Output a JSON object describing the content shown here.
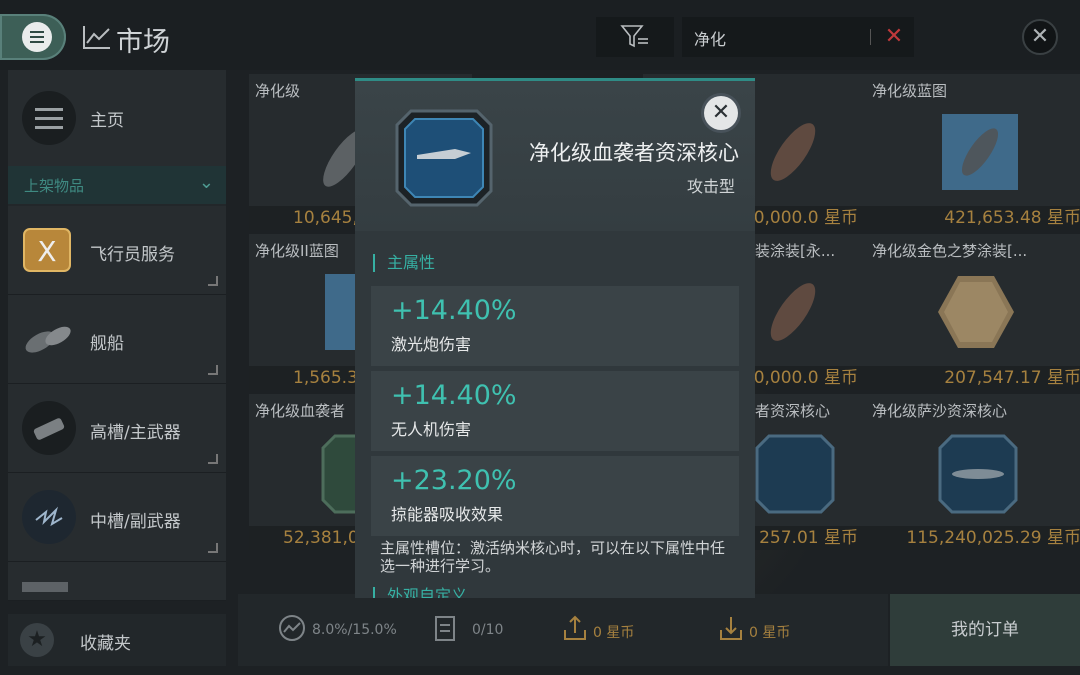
{
  "header": {
    "title": "市场",
    "search": {
      "value": "净化"
    }
  },
  "sidebar": {
    "home": "主页",
    "listed_header": "上架物品",
    "items": [
      {
        "label": "飞行员服务"
      },
      {
        "label": "舰船"
      },
      {
        "label": "高槽/主武器"
      },
      {
        "label": "中槽/副武器"
      }
    ],
    "favorites": "收藏夹"
  },
  "grid": {
    "cards": [
      {
        "name": "净化级",
        "price": "10,645,",
        "price_side": "left"
      },
      {
        "name": "",
        "price": "0,000.0 星币",
        "price_side": "right"
      },
      {
        "name": "净化级蓝图",
        "price": "421,653.48 星币",
        "price_side": "right"
      },
      {
        "name": "净化级II蓝图",
        "price": "1,565.3",
        "price_side": "left"
      },
      {
        "name": "装涂装[永...",
        "price": "0,000.0 星币",
        "price_side": "right"
      },
      {
        "name": "净化级金色之梦涂装[...",
        "price": "207,547.17 星币",
        "price_side": "right"
      },
      {
        "name": "净化级血袭者",
        "price": "52,381,0",
        "price_side": "left"
      },
      {
        "name": "者资深核心",
        "price": "257.01 星币",
        "price_side": "right"
      },
      {
        "name": "净化级萨沙资深核心",
        "price": "115,240,025.29 星币",
        "price_side": "right"
      }
    ]
  },
  "bottom": {
    "rate": "8.0%/15.0%",
    "orders_count": "0/10",
    "sell_amount": "0 星币",
    "buy_amount": "0 星币",
    "my_orders": "我的订单"
  },
  "modal": {
    "item_name": "净化级血袭者资深核心",
    "item_type": "攻击型",
    "main_attr_title": "主属性",
    "attributes": [
      {
        "value": "+14.40%",
        "label": "激光炮伤害"
      },
      {
        "value": "+14.40%",
        "label": "无人机伤害"
      },
      {
        "value": "+23.20%",
        "label": "掠能器吸收效果"
      }
    ],
    "description": "主属性槽位：激活纳米核心时，可以在以下属性中任选一种进行学习。",
    "next_section_title": "外观自定义"
  },
  "colors": {
    "accent_teal": "#3fc1b0",
    "price_gold": "#a6813f",
    "clear_red": "#c0393b"
  }
}
